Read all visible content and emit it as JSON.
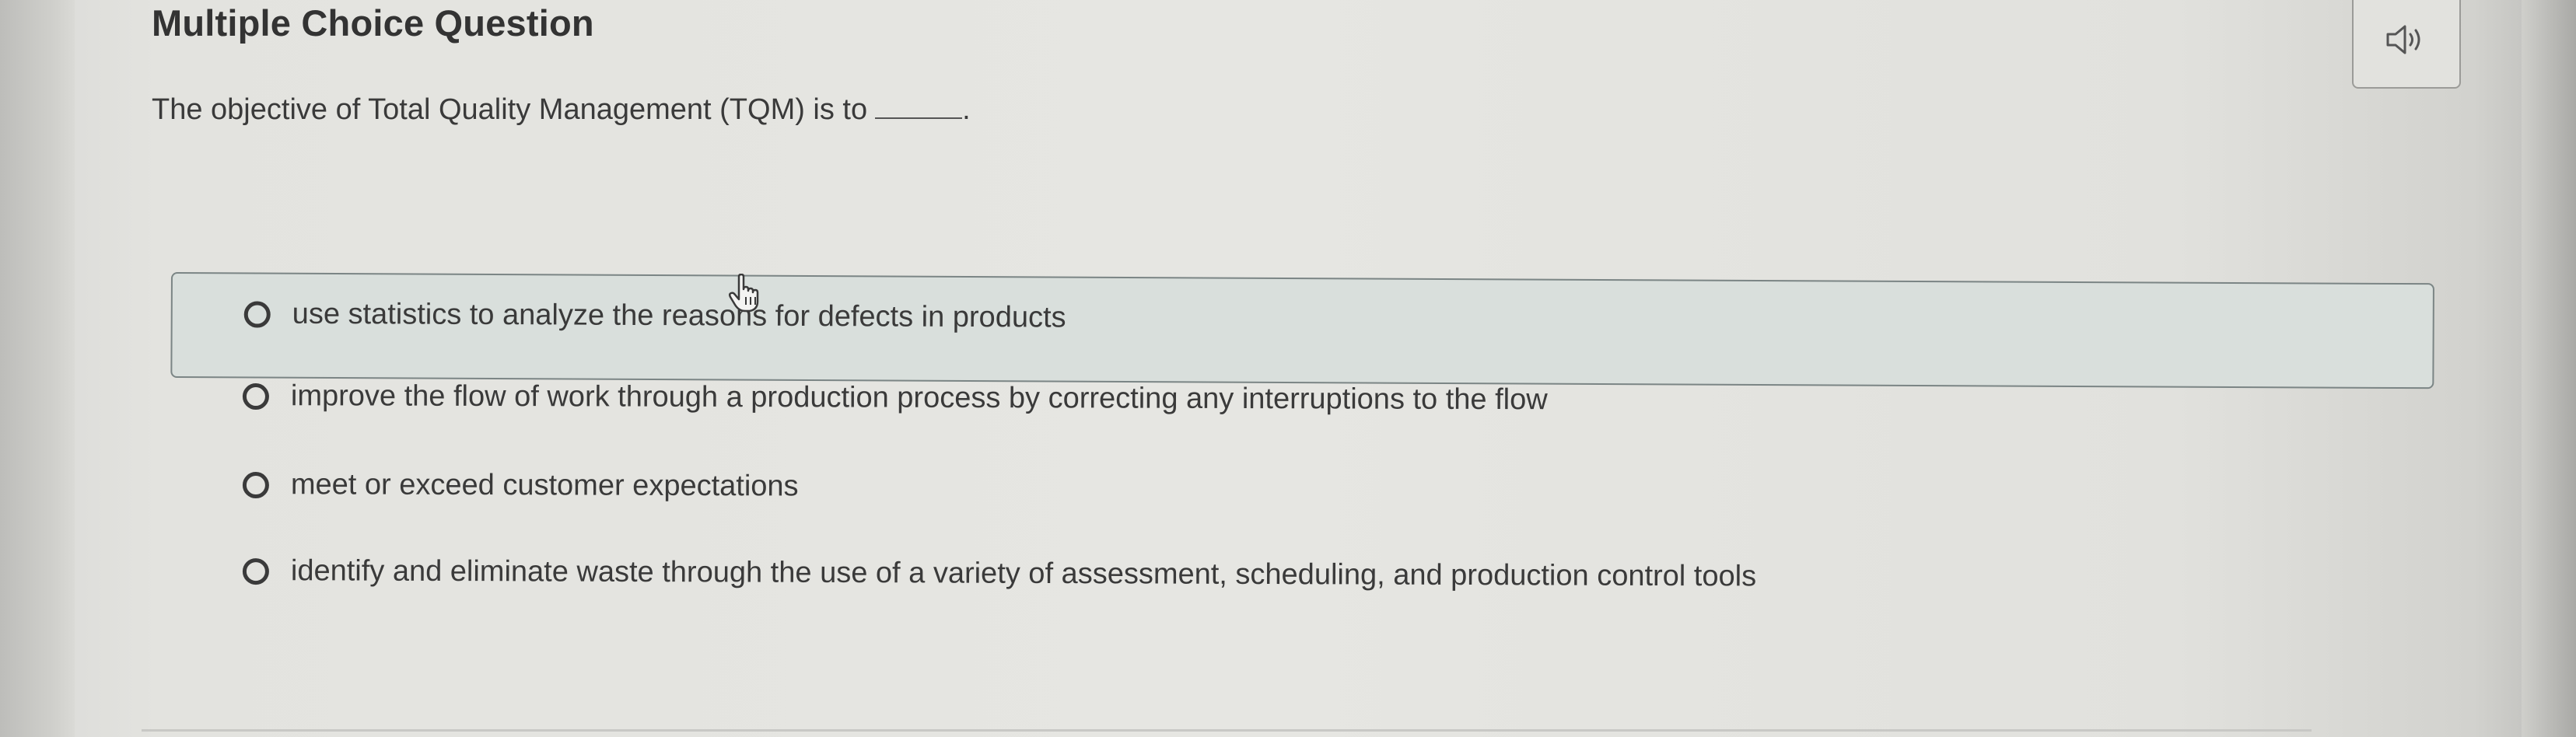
{
  "question": {
    "type_label": "Multiple Choice Question",
    "prompt": "The objective of Total Quality Management (TQM) is to",
    "prompt_end": "."
  },
  "audio_button": {
    "icon": "speaker-icon"
  },
  "options": [
    {
      "label": "use statistics to analyze the reasons for defects in products",
      "selected": false,
      "hovered": true
    },
    {
      "label": "improve the flow of work through a production process by correcting any interruptions to the flow",
      "selected": false
    },
    {
      "label": "meet or exceed customer expectations",
      "selected": false
    },
    {
      "label": "identify and eliminate waste through the use of a variety of assessment, scheduling, and production control tools",
      "selected": false
    }
  ],
  "colors": {
    "text": "#3a3a3a",
    "highlight_bg": "#d9dfdc",
    "highlight_border": "#7b8585"
  }
}
